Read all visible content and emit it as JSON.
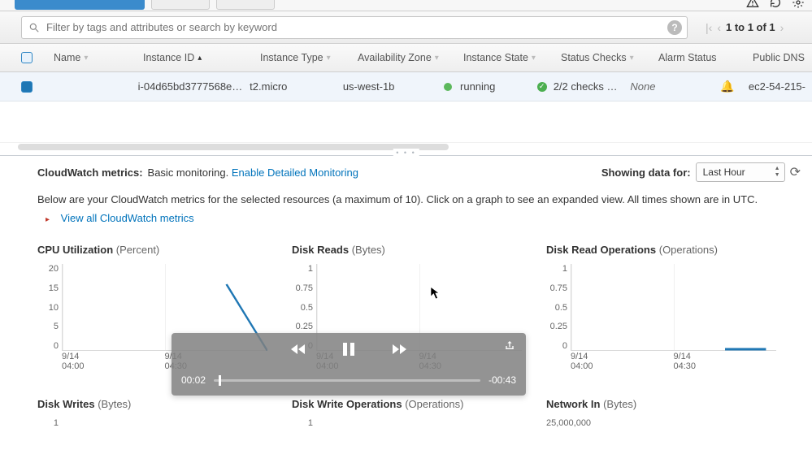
{
  "search": {
    "placeholder": "Filter by tags and attributes or search by keyword"
  },
  "pager": {
    "range": "1 to 1 of 1"
  },
  "columns": {
    "name": "Name",
    "instance_id": "Instance ID",
    "instance_type": "Instance Type",
    "az": "Availability Zone",
    "state": "Instance State",
    "status": "Status Checks",
    "alarm": "Alarm Status",
    "dns": "Public DNS"
  },
  "row": {
    "name": "",
    "instance_id": "i-04d65bd3777568e…",
    "instance_type": "t2.micro",
    "az": "us-west-1b",
    "state": "running",
    "status": "2/2 checks …",
    "alarm": "None",
    "dns": "ec2-54-215-"
  },
  "metrics_bar": {
    "label": "CloudWatch metrics:",
    "basic": "Basic monitoring.",
    "link": "Enable Detailed Monitoring",
    "showing": "Showing data for:",
    "range_selected": "Last Hour"
  },
  "description": "Below are your CloudWatch metrics for the selected resources (a maximum of 10). Click on a graph to see an expanded view. All times shown are in UTC.",
  "viewall": "View all CloudWatch metrics",
  "charts": {
    "cpu": {
      "title": "CPU Utilization",
      "unit": "(Percent)"
    },
    "dr": {
      "title": "Disk Reads",
      "unit": "(Bytes)"
    },
    "dro": {
      "title": "Disk Read Operations",
      "unit": "(Operations)"
    },
    "dw": {
      "title": "Disk Writes",
      "unit": "(Bytes)"
    },
    "dwo": {
      "title": "Disk Write Operations",
      "unit": "(Operations)"
    },
    "net": {
      "title": "Network In",
      "unit": "(Bytes)"
    }
  },
  "xaxis": {
    "a_date": "9/14",
    "a_time": "04:00",
    "b_date": "9/14",
    "b_time": "04:30"
  },
  "yaxis_cpu": [
    "20",
    "15",
    "10",
    "5",
    "0"
  ],
  "yaxis_unit": [
    "1",
    "0.75",
    "0.5",
    "0.25",
    "0"
  ],
  "yaxis_one": "1",
  "yaxis_net": "25,000,000",
  "video": {
    "elapsed": "00:02",
    "remaining": "-00:43"
  },
  "chart_data": [
    {
      "type": "line",
      "title": "CPU Utilization (Percent)",
      "xlabel": "",
      "ylabel": "",
      "x": [
        "9/14 04:00",
        "9/14 04:30"
      ],
      "values": [
        null,
        15
      ],
      "ylim": [
        0,
        20
      ]
    },
    {
      "type": "line",
      "title": "Disk Reads (Bytes)",
      "xlabel": "",
      "ylabel": "",
      "x": [
        "9/14 04:00",
        "9/14 04:30"
      ],
      "values": [
        0,
        0
      ],
      "ylim": [
        0,
        1
      ]
    },
    {
      "type": "line",
      "title": "Disk Read Operations (Operations)",
      "xlabel": "",
      "ylabel": "",
      "x": [
        "9/14 04:00",
        "9/14 04:30"
      ],
      "values": [
        0,
        0
      ],
      "ylim": [
        0,
        1
      ]
    },
    {
      "type": "line",
      "title": "Disk Writes (Bytes)",
      "xlabel": "",
      "ylabel": "",
      "x": [
        "9/14 04:00",
        "9/14 04:30"
      ],
      "values": [
        0,
        0
      ],
      "ylim": [
        0,
        1
      ]
    },
    {
      "type": "line",
      "title": "Disk Write Operations (Operations)",
      "xlabel": "",
      "ylabel": "",
      "x": [
        "9/14 04:00",
        "9/14 04:30"
      ],
      "values": [
        0,
        0
      ],
      "ylim": [
        0,
        1
      ]
    },
    {
      "type": "line",
      "title": "Network In (Bytes)",
      "xlabel": "",
      "ylabel": "",
      "x": [
        "9/14 04:00",
        "9/14 04:30"
      ],
      "values": [
        null,
        null
      ],
      "ylim": [
        0,
        25000000
      ]
    }
  ]
}
